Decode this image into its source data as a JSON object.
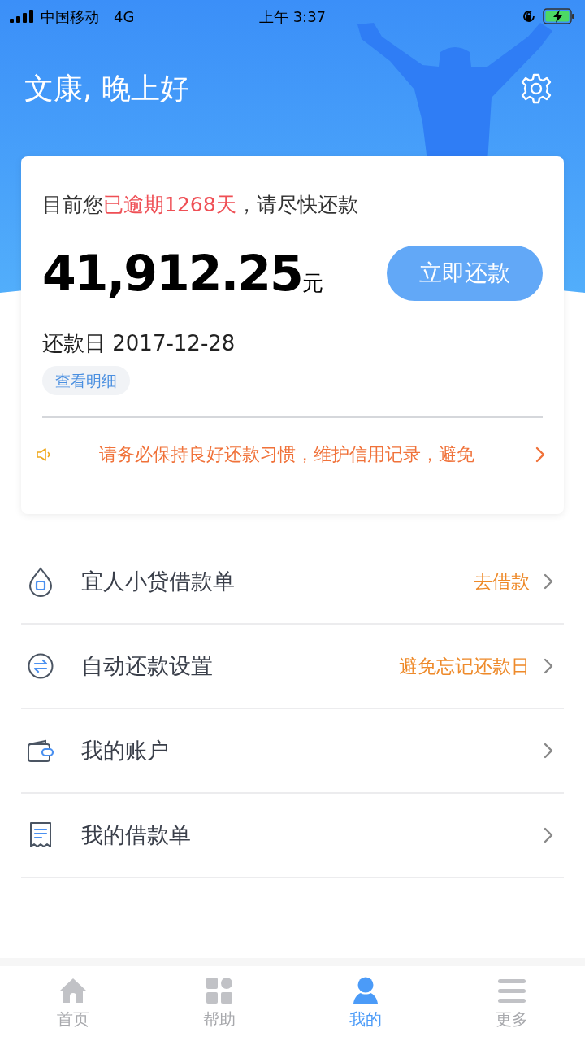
{
  "status_bar": {
    "carrier": "中国移动",
    "network": "4G",
    "time": "上午 3:37"
  },
  "header": {
    "greeting": "文康, 晚上好"
  },
  "bill_card": {
    "notice": {
      "before": "目前您",
      "highlight": "已逾期1268天",
      "after": "，请尽快还款"
    },
    "amount": "41,912.25",
    "unit": "元",
    "repay_button": "立即还款",
    "due_date": "还款日 2017-12-28",
    "detail_button": "查看明细",
    "marquee": "请务必保持良好还款习惯，维护信用记录，避免"
  },
  "menu": [
    {
      "label": "宜人小贷借款单",
      "hint": "去借款"
    },
    {
      "label": "自动还款设置",
      "hint": "避免忘记还款日"
    },
    {
      "label": "我的账户"
    },
    {
      "label": "我的借款单"
    }
  ],
  "tabs": [
    {
      "label": "首页",
      "selected": false
    },
    {
      "label": "帮助",
      "selected": false
    },
    {
      "label": "我的",
      "selected": true
    },
    {
      "label": "更多",
      "selected": false
    }
  ]
}
